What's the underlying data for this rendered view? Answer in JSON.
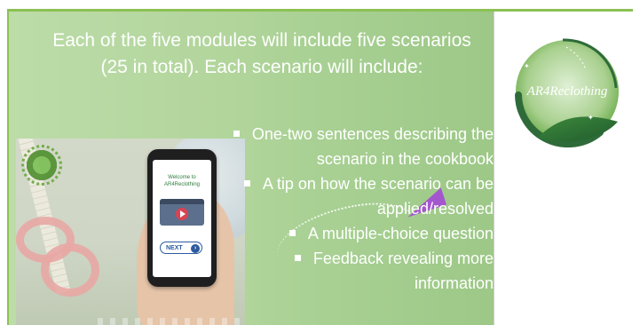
{
  "slide": {
    "heading": "Each of the five modules will include five scenarios (25 in total). Each scenario will include:",
    "bullets": [
      "One-two sentences describing the scenario in the cookbook",
      "A tip on how the scenario can be applied/resolved",
      "A multiple-choice question",
      "Feedback revealing more information"
    ]
  },
  "phone": {
    "welcome_line1": "Welcome to",
    "welcome_line2": "AR4Reclothing",
    "next_label": "NEXT",
    "next_icon": "chevron-right-icon",
    "video_icon": "play-icon"
  },
  "logo": {
    "text": "AR4Reclothing"
  },
  "colors": {
    "accent_green": "#8cc152",
    "panel_green": "#b2d59c",
    "logo_dark_green": "#2f6b3a",
    "plane_purple": "#a44ad4"
  }
}
